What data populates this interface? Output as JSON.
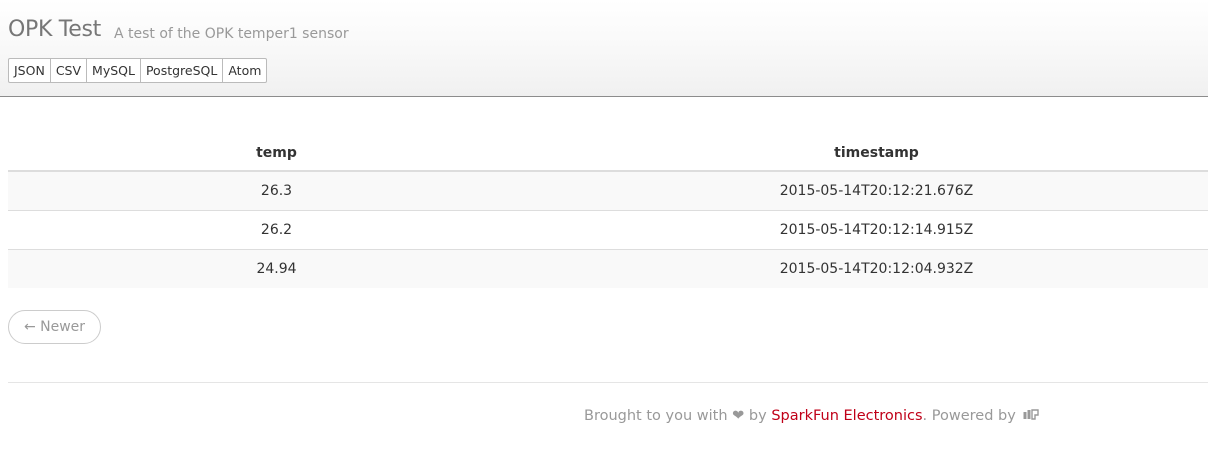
{
  "header": {
    "title": "OPK Test",
    "subtitle": "A test of the OPK temper1 sensor",
    "formats": [
      "JSON",
      "CSV",
      "MySQL",
      "PostgreSQL",
      "Atom"
    ]
  },
  "table": {
    "columns": [
      "temp",
      "timestamp"
    ],
    "rows": [
      [
        "26.3",
        "2015-05-14T20:12:21.676Z"
      ],
      [
        "26.2",
        "2015-05-14T20:12:14.915Z"
      ],
      [
        "24.94",
        "2015-05-14T20:12:04.932Z"
      ]
    ]
  },
  "pagination": {
    "newer_label": "← Newer"
  },
  "footer": {
    "prefix": "Brought to you with",
    "heart": "❤",
    "by": "by",
    "company": "SparkFun Electronics",
    "powered": ". Powered by",
    "logo_icon": "phant-logo-icon",
    "link_color": "#c00018"
  }
}
